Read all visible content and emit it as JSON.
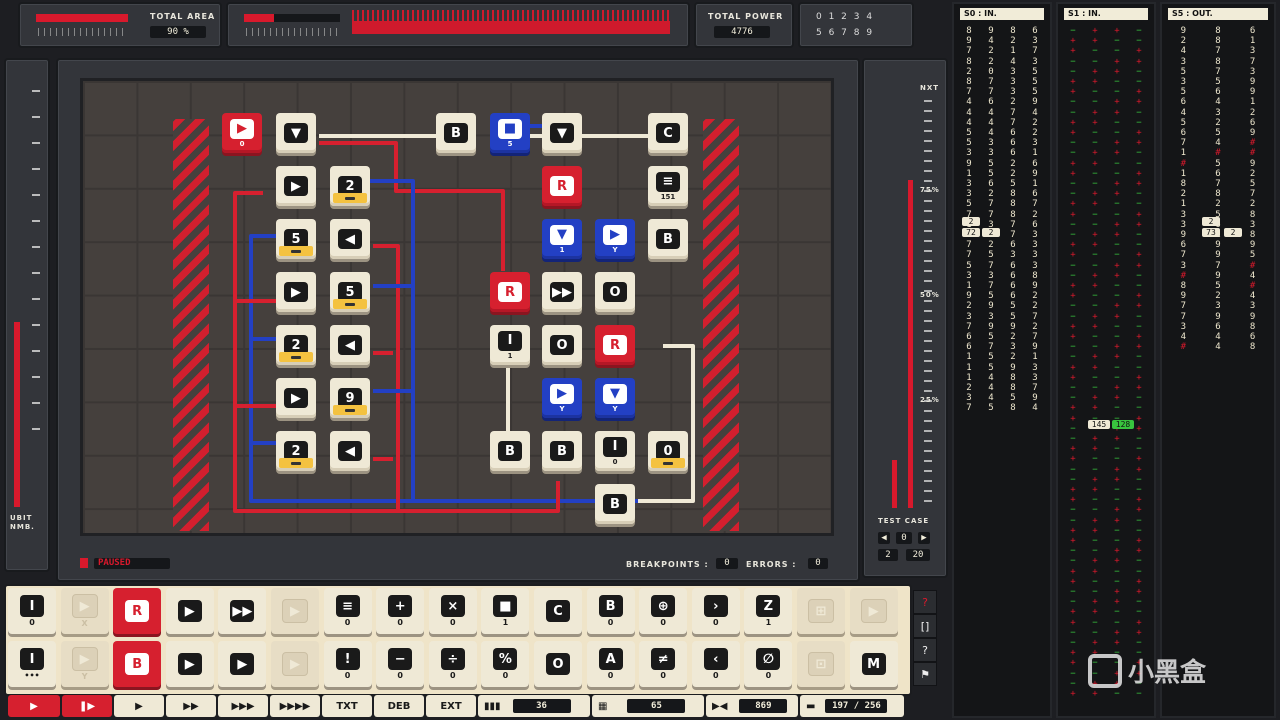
{
  "top": {
    "total_area_label": "TOTAL AREA",
    "total_area_value": "90 %",
    "total_power_label": "TOTAL POWER",
    "total_power_value": "4776",
    "digits_row1": "0 1 2 3 4",
    "digits_row2": "5 6 7 8 9"
  },
  "left_gauge": {
    "label": "UBIT NMB."
  },
  "status": {
    "state": "PAUSED",
    "breakpoints_label": "BREAKPOINTS :",
    "breakpoints_value": "0",
    "errors_label": "ERRORS :",
    "errors_value": "0"
  },
  "right_gauge": {
    "nxt": "NXT",
    "p75": "75%",
    "p50": "50%",
    "p25": "25%",
    "test_case_label": "TEST CASE",
    "test_case_value": "0",
    "test_case_index": "2",
    "test_case_total": "20"
  },
  "board_chips": [
    {
      "g": "▶",
      "cap": "0",
      "type": "red"
    },
    {
      "g": "▼",
      "cap": "",
      "type": "plain"
    },
    {
      "g": "B",
      "cap": "",
      "type": "plain"
    },
    {
      "g": "■",
      "cap": "5",
      "type": "blue"
    },
    {
      "g": "▼",
      "cap": "",
      "type": "plain"
    },
    {
      "g": "C",
      "cap": "",
      "type": "plain"
    },
    {
      "g": "▶",
      "cap": "",
      "type": "plain"
    },
    {
      "g": "2",
      "cap": "",
      "type": "plain"
    },
    {
      "g": "R",
      "cap": "",
      "type": "red"
    },
    {
      "g": "≡",
      "cap": "151",
      "type": "plain"
    },
    {
      "g": "5",
      "cap": "",
      "type": "plain"
    },
    {
      "g": "◀",
      "cap": "",
      "type": "plain"
    },
    {
      "g": "▼",
      "cap": "1",
      "type": "blue"
    },
    {
      "g": "▶",
      "cap": "Y",
      "type": "blue"
    },
    {
      "g": "B",
      "cap": "",
      "type": "plain"
    },
    {
      "g": "▶",
      "cap": "",
      "type": "plain"
    },
    {
      "g": "5",
      "cap": "",
      "type": "plain"
    },
    {
      "g": "R",
      "cap": "",
      "type": "red"
    },
    {
      "g": "▶▶",
      "cap": "",
      "type": "plain"
    },
    {
      "g": "O",
      "cap": "",
      "type": "plain"
    },
    {
      "g": "2",
      "cap": "",
      "type": "plain"
    },
    {
      "g": "◀",
      "cap": "",
      "type": "plain"
    },
    {
      "g": "I",
      "cap": "1",
      "type": "plain"
    },
    {
      "g": "O",
      "cap": "",
      "type": "plain"
    },
    {
      "g": "R",
      "cap": "",
      "type": "red"
    },
    {
      "g": "▶",
      "cap": "",
      "type": "plain"
    },
    {
      "g": "9",
      "cap": "",
      "type": "plain"
    },
    {
      "g": "▶",
      "cap": "Y",
      "type": "blue"
    },
    {
      "g": "▼",
      "cap": "Y",
      "type": "blue"
    },
    {
      "g": "2",
      "cap": "",
      "type": "plain"
    },
    {
      "g": "◀",
      "cap": "",
      "type": "plain"
    },
    {
      "g": "B",
      "cap": "",
      "type": "plain"
    },
    {
      "g": "B",
      "cap": "",
      "type": "plain"
    },
    {
      "g": "I",
      "cap": "0",
      "type": "plain"
    },
    {
      "g": "0",
      "cap": "",
      "type": "plain"
    },
    {
      "g": "B",
      "cap": "",
      "type": "plain"
    }
  ],
  "io": {
    "s0_label": "S0 : IN.",
    "s1_label": "S1 : IN.",
    "s5_label": "S5 : OUT.",
    "s0_rows": [
      "8 9 8 6",
      "9 4 2 3",
      "7 2 1 7",
      "8 2 4 3",
      "2 0 3 5",
      "8 7 3 5",
      "7 7 3 5",
      "4 6 2 9",
      "4 4 7 4",
      "4 4 7 2",
      "5 4 6 2",
      "5 3 6 3",
      "3 3 6 1",
      "9 5 2 6",
      "1 5 2 9",
      "3 6 5 1",
      "3 2 8 6",
      "5 7 8 7",
      "7 7 8 2",
      "1 3 7 6",
      "2 4 7 3",
      "7 2 6 3",
      "7 5 3 3",
      "5 7 6 3",
      "3 3 6 8",
      "1 7 6 9",
      "9 5 6 2",
      "2 9 5 2",
      "3 3 5 7",
      "7 9 9 2",
      "6 5 2 7",
      "6 7 3 9",
      "1 5 2 1",
      "1 5 9 3",
      "1 4 8 3",
      "2 4 8 7",
      "3 4 5 9",
      "7 5 8 4"
    ],
    "s0_cursor_a": "2",
    "s0_cursor_b": "72",
    "s0_cursor_c": "2",
    "s1_cursor_a": "145",
    "s1_cursor_b": "128",
    "s5_rows": [
      "9 8 6",
      "2 8 1",
      "4 7 3",
      "3 8 7",
      "5 7 3",
      "3 5 9",
      "5 6 9",
      "6 4 1",
      "4 3 2",
      "5 2 6",
      "6 5 9",
      "7 4 #",
      "1 # #",
      "# 5 9",
      "1 6 2",
      "8 7 5",
      "2 8 7",
      "1 2 2",
      "3 5 8",
      "3 6 3",
      "9 1 8",
      "6 9 9",
      "7 9 5",
      "3 7 #",
      "# 9 4",
      "8 5 #",
      "9 2 4",
      "7 3 3",
      "7 9 9",
      "3 6 8",
      "4 4 6",
      "# 4 8"
    ],
    "s5_cursor_a": "2",
    "s5_cursor_b": "73",
    "s5_cursor_c": "2"
  },
  "palette": {
    "row1": [
      {
        "g": "I",
        "c": "0",
        "k": "plain"
      },
      {
        "g": "▶",
        "c": "X",
        "k": "dim"
      },
      {
        "g": "R",
        "c": "",
        "k": "red"
      },
      {
        "g": "▶",
        "c": "",
        "k": "plain"
      },
      {
        "g": "▶▶",
        "c": "",
        "k": "plain"
      },
      {
        "g": "▶",
        "c": "",
        "k": "dim"
      },
      {
        "g": "≡",
        "c": "0",
        "k": "plain"
      },
      {
        "g": "+",
        "c": "0",
        "k": "plain"
      },
      {
        "g": "×",
        "c": "0",
        "k": "plain"
      },
      {
        "g": "■",
        "c": "1",
        "k": "plain"
      },
      {
        "g": "C",
        "c": "",
        "k": "plain"
      },
      {
        "g": "B",
        "c": "0",
        "k": "plain"
      },
      {
        "g": "⊕",
        "c": "0",
        "k": "plain"
      },
      {
        "g": "›",
        "c": "0",
        "k": "plain"
      },
      {
        "g": "Z",
        "c": "1",
        "k": "plain"
      },
      {
        "g": "⊞",
        "c": "",
        "k": "dim"
      },
      {
        "g": "▶",
        "c": "",
        "k": "dim"
      }
    ],
    "row2": [
      {
        "g": "I",
        "c": "•••",
        "k": "plain"
      },
      {
        "g": "▶",
        "c": "Y",
        "k": "dim"
      },
      {
        "g": "B",
        "c": "",
        "k": "red"
      },
      {
        "g": "▶",
        "c": "",
        "k": "plain"
      },
      {
        "g": "▶",
        "c": "",
        "k": "plain"
      },
      {
        "g": "▶",
        "c": "",
        "k": "dim"
      },
      {
        "g": "!",
        "c": "0",
        "k": "plain"
      },
      {
        "g": "−",
        "c": "0",
        "k": "plain"
      },
      {
        "g": "÷",
        "c": "0",
        "k": "plain"
      },
      {
        "g": "%",
        "c": "0",
        "k": "plain"
      },
      {
        "g": "O",
        "c": "",
        "k": "plain"
      },
      {
        "g": "A",
        "c": "0",
        "k": "plain"
      },
      {
        "g": "≠",
        "c": "0",
        "k": "plain"
      },
      {
        "g": "‹",
        "c": "0",
        "k": "plain"
      },
      {
        "g": "∅",
        "c": "0",
        "k": "plain"
      },
      {
        "g": "⊡",
        "c": "",
        "k": "dim"
      },
      {
        "g": "M",
        "c": "",
        "k": "plain"
      }
    ]
  },
  "controls": {
    "txt": "TXT",
    "deb": "DEB",
    "ext": "EXT",
    "v1": "36",
    "v2": "65",
    "v3": "869",
    "v4": "197 / 256"
  },
  "sidebar_buttons": [
    "?",
    "[]",
    "?",
    "⚑"
  ],
  "watermark": "小黑盒",
  "colors": {
    "red": "#d6202f",
    "blue": "#2340c4",
    "cream": "#efe9d6",
    "yellow": "#f4c240",
    "green": "#38c43e"
  }
}
